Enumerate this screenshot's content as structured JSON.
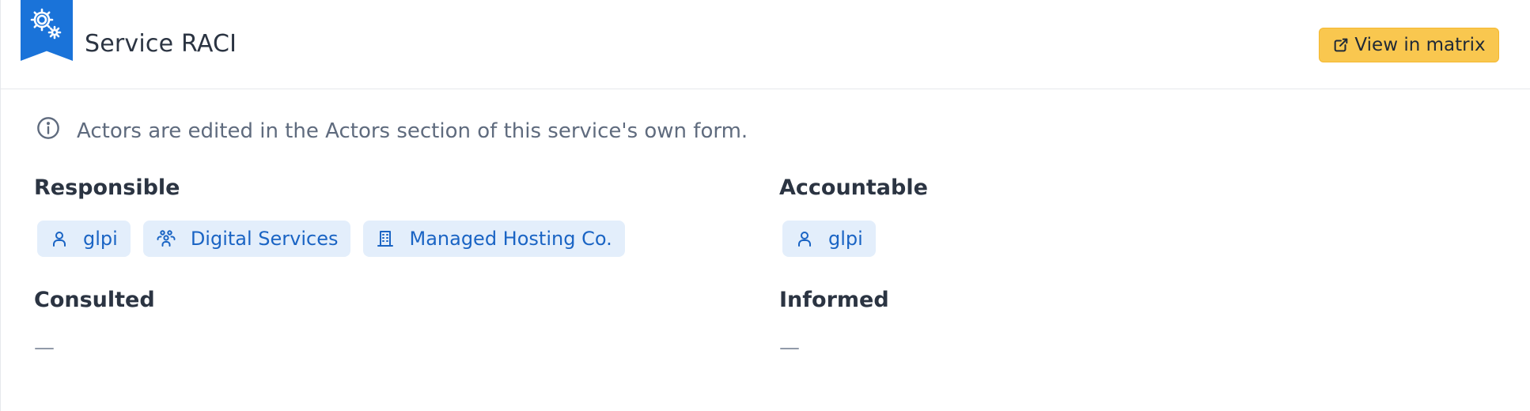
{
  "header": {
    "title": "Service RACI",
    "icon": "gears-icon",
    "button_label": "View in matrix",
    "button_icon": "external-link-icon"
  },
  "note": {
    "icon": "info-icon",
    "text": "Actors are edited in the Actors section of this service's own form."
  },
  "sections": {
    "responsible": {
      "title": "Responsible",
      "actors": [
        {
          "icon": "user-icon",
          "label": "glpi"
        },
        {
          "icon": "group-icon",
          "label": "Digital Services"
        },
        {
          "icon": "building-icon",
          "label": "Managed Hosting Co."
        }
      ]
    },
    "accountable": {
      "title": "Accountable",
      "actors": [
        {
          "icon": "user-icon",
          "label": "glpi"
        }
      ]
    },
    "consulted": {
      "title": "Consulted",
      "empty": "—"
    },
    "informed": {
      "title": "Informed",
      "empty": "—"
    }
  },
  "colors": {
    "ribbon": "#1a73d9",
    "button": "#f9c74f",
    "chip_bg": "#e3eefb",
    "chip_text": "#1a64c4"
  }
}
